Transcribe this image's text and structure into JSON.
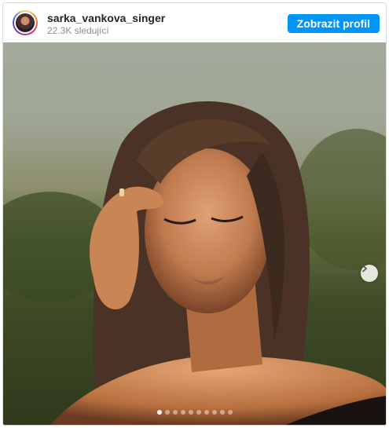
{
  "profile": {
    "username": "sarka_vankova_singer",
    "followers": "22.3K sledující",
    "view_profile_label": "Zobrazit profil"
  },
  "media": {
    "photo": "portrait-photo",
    "next_icon": "chevron-right-icon"
  },
  "carousel": {
    "total_slides": 10,
    "active_slide": 1
  },
  "colors": {
    "accent": "#0095f6",
    "username": "#262626",
    "secondary_text": "#8e8e8e",
    "border": "#dbdbdb"
  }
}
